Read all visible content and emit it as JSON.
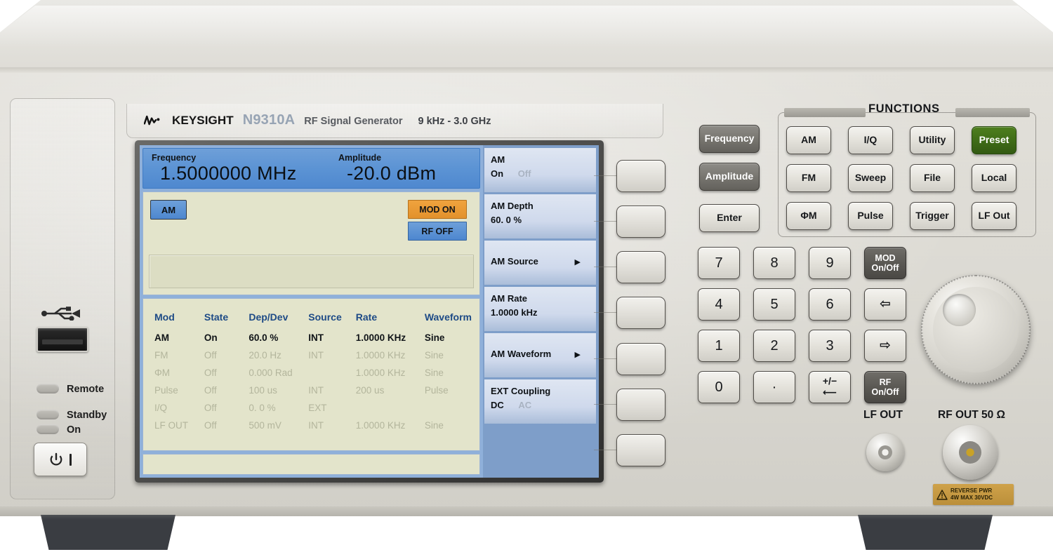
{
  "branding": {
    "logo_icon": "keysight-wave-logo",
    "name": "KEYSIGHT",
    "model": "N9310A",
    "description": "RF Signal Generator",
    "range": "9 kHz - 3.0 GHz"
  },
  "left_panel": {
    "usb_icon": "usb-icon",
    "indicators": [
      {
        "label": "Remote"
      },
      {
        "label": "Standby"
      },
      {
        "label": "On"
      }
    ],
    "power_button": {
      "icon": "power-icon",
      "mark": "|"
    }
  },
  "display": {
    "banner": {
      "frequency_label": "Frequency",
      "frequency_value": "1.5000000 MHz",
      "amplitude_label": "Amplitude",
      "amplitude_value": "-20.0 dBm"
    },
    "mod_chip": "AM",
    "status_chips": [
      {
        "label": "MOD ON",
        "color": "#e2912c"
      },
      {
        "label": "RF OFF",
        "color": "#4d87cf"
      }
    ],
    "entry_field_value": "",
    "status_strip_value": "",
    "table": {
      "headers": [
        "Mod",
        "State",
        "Dep/Dev",
        "Source",
        "Rate",
        "Waveform"
      ],
      "rows": [
        {
          "active": true,
          "cells": [
            "AM",
            "On",
            "60.0 %",
            "INT",
            "1.0000 KHz",
            "Sine"
          ]
        },
        {
          "active": false,
          "cells": [
            "FM",
            "Off",
            "20.0 Hz",
            "INT",
            "1.0000 KHz",
            "Sine"
          ]
        },
        {
          "active": false,
          "cells": [
            "ΦM",
            "Off",
            "0.000 Rad",
            "",
            "1.0000 KHz",
            "Sine"
          ]
        },
        {
          "active": false,
          "cells": [
            "Pulse",
            "Off",
            "100 us",
            "INT",
            "200 us",
            "Pulse"
          ]
        },
        {
          "active": false,
          "cells": [
            "I/Q",
            "Off",
            "0. 0 %",
            "EXT",
            "",
            ""
          ]
        },
        {
          "active": false,
          "cells": [
            "LF OUT",
            "Off",
            "500 mV",
            "INT",
            "1.0000 KHz",
            "Sine"
          ]
        }
      ]
    },
    "softkeys": [
      {
        "line1": "AM",
        "line2": "On",
        "line2_alt": "Off",
        "arrow": false
      },
      {
        "line1": "AM  Depth",
        "line2": "60. 0 %",
        "line2_alt": "",
        "arrow": false
      },
      {
        "line1": "AM  Source",
        "line2": "",
        "line2_alt": "",
        "arrow": true
      },
      {
        "line1": "AM  Rate",
        "line2": "1.0000 kHz",
        "line2_alt": "",
        "arrow": false
      },
      {
        "line1": "AM  Waveform",
        "line2": "",
        "line2_alt": "",
        "arrow": true
      },
      {
        "line1": "EXT  Coupling",
        "line2": "DC",
        "line2_alt": "AC",
        "arrow": false
      }
    ]
  },
  "hard_softkeys": [
    {
      "name": "softkey-1"
    },
    {
      "name": "softkey-2"
    },
    {
      "name": "softkey-3"
    },
    {
      "name": "softkey-4"
    },
    {
      "name": "softkey-5"
    },
    {
      "name": "softkey-6"
    },
    {
      "name": "softkey-7"
    }
  ],
  "right_panel": {
    "functions_title": "FUNCTIONS",
    "mode_keys": [
      {
        "label": "Frequency",
        "style": "dark"
      },
      {
        "label": "Amplitude",
        "style": "dark"
      },
      {
        "label": "Enter",
        "style": "light"
      }
    ],
    "function_keys": [
      {
        "label": "AM",
        "style": "light"
      },
      {
        "label": "I/Q",
        "style": "light"
      },
      {
        "label": "Utility",
        "style": "light"
      },
      {
        "label": "Preset",
        "style": "green"
      },
      {
        "label": "FM",
        "style": "light"
      },
      {
        "label": "Sweep",
        "style": "light"
      },
      {
        "label": "File",
        "style": "light"
      },
      {
        "label": "Local",
        "style": "light"
      },
      {
        "label": "ΦM",
        "style": "light"
      },
      {
        "label": "Pulse",
        "style": "light"
      },
      {
        "label": "Trigger",
        "style": "light"
      },
      {
        "label": "LF Out",
        "style": "light"
      }
    ],
    "keypad": [
      {
        "label": "7",
        "style": "num"
      },
      {
        "label": "8",
        "style": "num"
      },
      {
        "label": "9",
        "style": "num"
      },
      {
        "label": "MOD\nOn/Off",
        "style": "darker"
      },
      {
        "label": "4",
        "style": "num"
      },
      {
        "label": "5",
        "style": "num"
      },
      {
        "label": "6",
        "style": "num"
      },
      {
        "label": "⇦",
        "style": "glyph"
      },
      {
        "label": "1",
        "style": "num"
      },
      {
        "label": "2",
        "style": "num"
      },
      {
        "label": "3",
        "style": "num"
      },
      {
        "label": "⇨",
        "style": "glyph"
      },
      {
        "label": "0",
        "style": "num"
      },
      {
        "label": "·",
        "style": "num"
      },
      {
        "label": "+/−\n⟵",
        "style": "glyph"
      },
      {
        "label": "RF\nOn/Off",
        "style": "darker"
      }
    ],
    "knob": {
      "icon": "rotary-knob"
    },
    "connectors": {
      "lf_out_label": "LF OUT",
      "rf_out_label": "RF  OUT 50 Ω",
      "warning_icon": "warning-triangle-icon",
      "warning_line1": "REVERSE PWR",
      "warning_line2": "4W MAX 30VDC"
    }
  }
}
